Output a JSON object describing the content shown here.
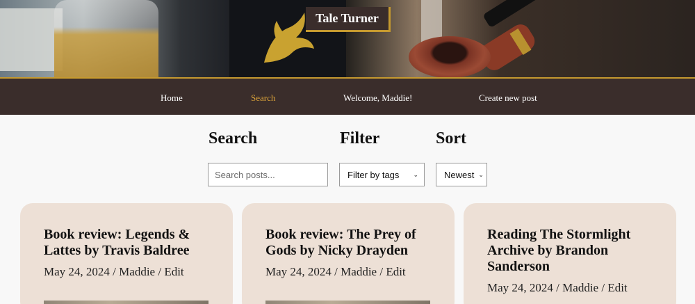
{
  "brand": {
    "title": "Tale Turner"
  },
  "nav": {
    "items": [
      {
        "label": "Home"
      },
      {
        "label": "Search"
      },
      {
        "label": "Welcome, Maddie!"
      },
      {
        "label": "Create new post"
      }
    ]
  },
  "controls": {
    "search_heading": "Search",
    "filter_heading": "Filter",
    "sort_heading": "Sort",
    "search_placeholder": "Search posts...",
    "filter_value": "Filter by tags",
    "sort_value": "Newest"
  },
  "posts": [
    {
      "title": "Book review: Legends & Lattes by Travis Baldree",
      "date": "May 24, 2024",
      "author": "Maddie",
      "edit": "Edit",
      "sep": " / "
    },
    {
      "title": "Book review: The Prey of Gods by Nicky Drayden",
      "date": "May 24, 2024",
      "author": "Maddie",
      "edit": "Edit",
      "sep": " / "
    },
    {
      "title": "Reading The Stormlight Archive by Brandon Sanderson",
      "date": "May 24, 2024",
      "author": "Maddie",
      "edit": "Edit",
      "sep": " / "
    }
  ],
  "colors": {
    "nav_bg": "#3a2d2b",
    "accent": "#c69a2f",
    "active_link": "#d9a13a",
    "card_bg": "#ede0d6"
  }
}
